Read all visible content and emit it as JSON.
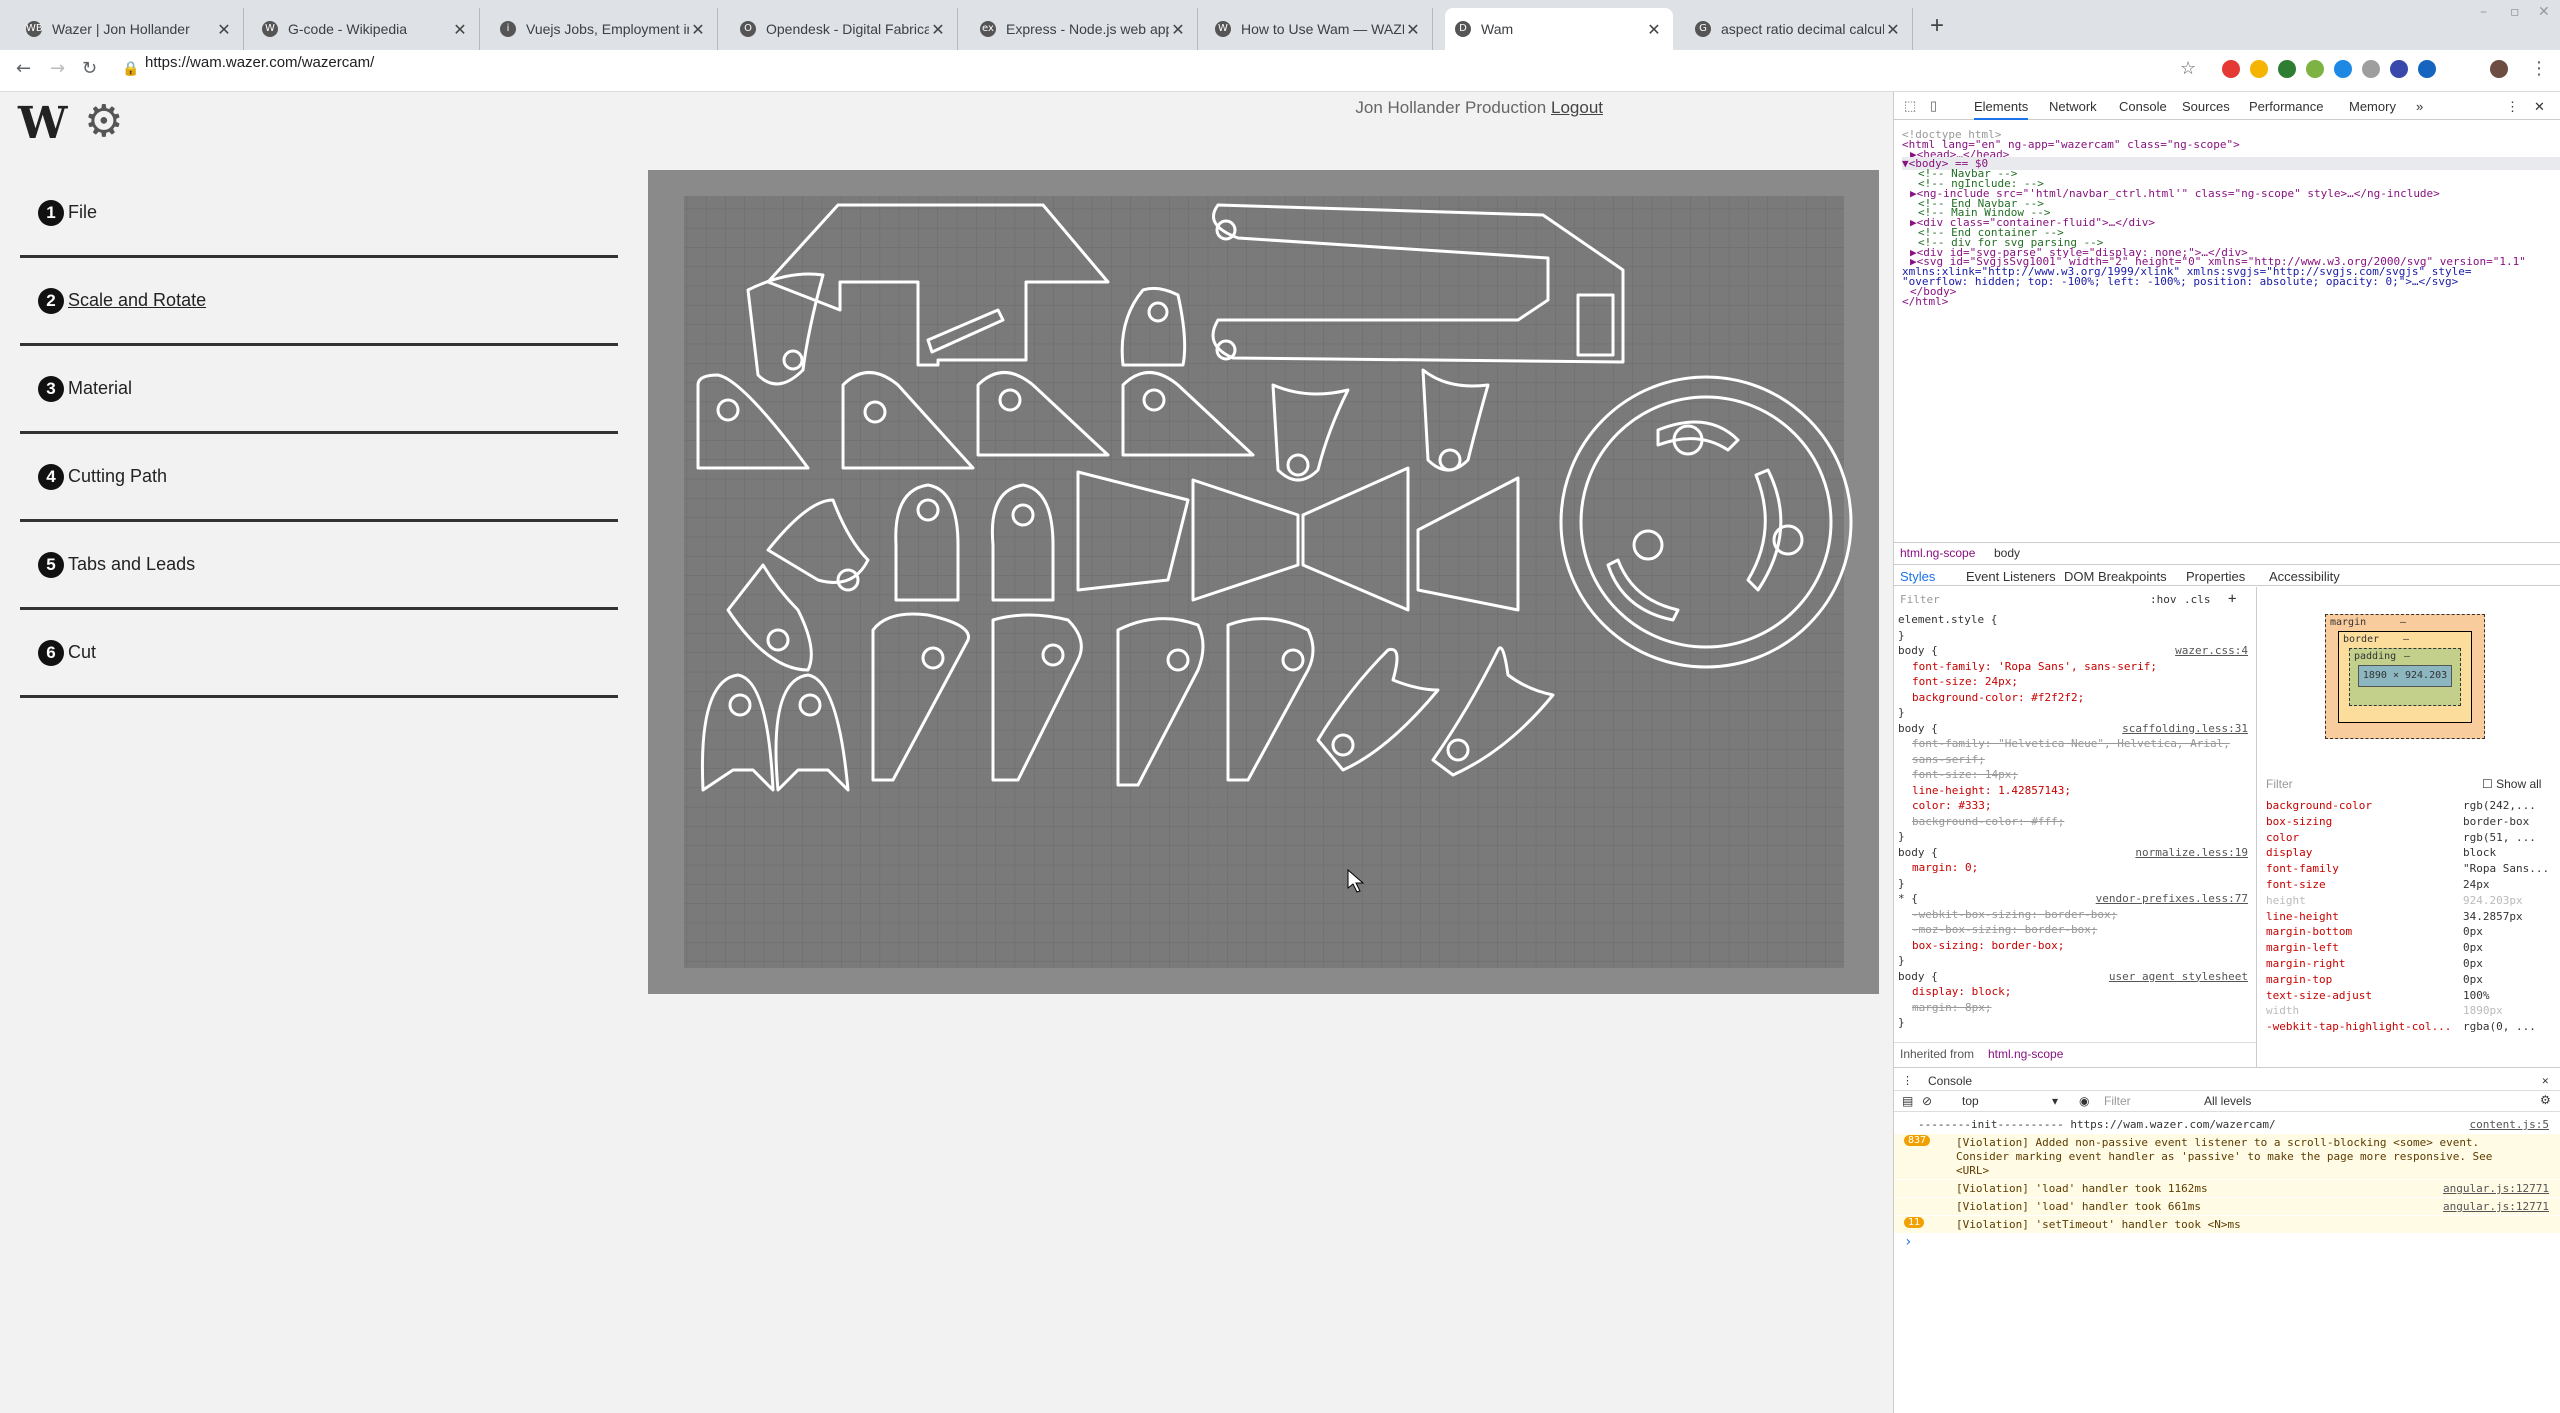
{
  "tabs": [
    {
      "label": "Wazer | Jon Hollander",
      "icon": "WB"
    },
    {
      "label": "G-code - Wikipedia",
      "icon": "W"
    },
    {
      "label": "Vuejs Jobs, Employment in San",
      "icon": "i"
    },
    {
      "label": "Opendesk - Digital Fabrication",
      "icon": "O"
    },
    {
      "label": "Express - Node.js web applicati",
      "icon": "ex"
    },
    {
      "label": "How to Use Wam — WAZER | T",
      "icon": "W"
    },
    {
      "label": "Wam",
      "icon": "D"
    },
    {
      "label": "aspect ratio decimal calculator",
      "icon": "G"
    }
  ],
  "url": "https://wam.wazer.com/wazercam/",
  "app": {
    "logo": "W",
    "user": "Jon Hollander Production",
    "logout": "Logout",
    "steps": [
      {
        "num": "1",
        "label": "File"
      },
      {
        "num": "2",
        "label": "Scale and Rotate"
      },
      {
        "num": "3",
        "label": "Material"
      },
      {
        "num": "4",
        "label": "Cutting Path"
      },
      {
        "num": "5",
        "label": "Tabs and Leads"
      },
      {
        "num": "6",
        "label": "Cut"
      }
    ]
  },
  "devtools": {
    "tabs": [
      "Elements",
      "Network",
      "Console",
      "Sources",
      "Performance",
      "Memory"
    ],
    "dom": [
      "<!doctype html>",
      "<html lang=\"en\" ng-app=\"wazercam\" class=\"ng-scope\">",
      "▶<head>…</head>",
      "▼<body> == $0",
      "<!-- Navbar -->",
      "<!-- ngInclude: -->",
      "▶<ng-include src=\"'html/navbar_ctrl.html'\" class=\"ng-scope\" style>…</ng-include>",
      "<!-- End Navbar -->",
      "<!-- Main Window -->",
      "▶<div class=\"container-fluid\">…</div>",
      "<!-- End container -->",
      "<!-- div for svg parsing -->",
      "▶<div id=\"svg-parse\" style=\"display: none;\">…</div>",
      "▶<svg id=\"SvgjsSvg1001\" width=\"2\" height=\"0\" xmlns=\"http://www.w3.org/2000/svg\" version=\"1.1\"",
      "xmlns:xlink=\"http://www.w3.org/1999/xlink\" xmlns:svgjs=\"http://svgjs.com/svgjs\" style=",
      "\"overflow: hidden; top: -100%; left: -100%; position: absolute; opacity: 0;\">…</svg>",
      "</body>",
      "</html>"
    ],
    "crumbs": [
      "html.ng-scope",
      "body"
    ],
    "subtabs": [
      "Styles",
      "Event Listeners",
      "DOM Breakpoints",
      "Properties",
      "Accessibility"
    ],
    "filter": "Filter",
    "hov": ":hov",
    "cls": ".cls",
    "styles": [
      {
        "text": "element.style {",
        "cls": "",
        "src": ""
      },
      {
        "text": "}",
        "cls": "",
        "src": ""
      },
      {
        "text": "body {",
        "cls": "",
        "src": "wazer.css:4"
      },
      {
        "text": "font-family: 'Ropa Sans', sans-serif;",
        "cls": "prop",
        "src": ""
      },
      {
        "text": "font-size: 24px;",
        "cls": "prop",
        "src": ""
      },
      {
        "text": "background-color: #f2f2f2;",
        "cls": "prop",
        "src": ""
      },
      {
        "text": "}",
        "cls": "",
        "src": ""
      },
      {
        "text": "body {",
        "cls": "",
        "src": "scaffolding.less:31"
      },
      {
        "text": "font-family: \"Helvetica Neue\", Helvetica, Arial,",
        "cls": "strike",
        "src": ""
      },
      {
        "text": "sans-serif;",
        "cls": "strike",
        "src": ""
      },
      {
        "text": "font-size: 14px;",
        "cls": "strike",
        "src": ""
      },
      {
        "text": "line-height: 1.42857143;",
        "cls": "prop",
        "src": ""
      },
      {
        "text": "color: #333;",
        "cls": "prop",
        "src": ""
      },
      {
        "text": "background-color: #fff;",
        "cls": "strike",
        "src": ""
      },
      {
        "text": "}",
        "cls": "",
        "src": ""
      },
      {
        "text": "body {",
        "cls": "",
        "src": "normalize.less:19"
      },
      {
        "text": "margin: 0;",
        "cls": "prop",
        "src": ""
      },
      {
        "text": "}",
        "cls": "",
        "src": ""
      },
      {
        "text": "* {",
        "cls": "",
        "src": "vendor-prefixes.less:77"
      },
      {
        "text": "-webkit-box-sizing: border-box;",
        "cls": "strike",
        "src": ""
      },
      {
        "text": "-moz-box-sizing: border-box;",
        "cls": "strike",
        "src": ""
      },
      {
        "text": "box-sizing: border-box;",
        "cls": "prop",
        "src": ""
      },
      {
        "text": "}",
        "cls": "",
        "src": ""
      },
      {
        "text": "body {",
        "cls": "",
        "src": "user agent stylesheet"
      },
      {
        "text": "display: block;",
        "cls": "prop",
        "src": ""
      },
      {
        "text": "margin: 8px;",
        "cls": "strike",
        "src": ""
      },
      {
        "text": "}",
        "cls": "",
        "src": ""
      }
    ],
    "inherited": "Inherited from",
    "inherited_from": "html.ng-scope",
    "boxmodel": {
      "margin": "margin",
      "border": "border",
      "padding": "padding",
      "content": "1890 × 924.203",
      "dash": "–"
    },
    "show_all": "Show all",
    "computed": [
      {
        "prop": "background-color",
        "val": "rgb(242,..."
      },
      {
        "prop": "box-sizing",
        "val": "border-box"
      },
      {
        "prop": "color",
        "val": "rgb(51, ..."
      },
      {
        "prop": "display",
        "val": "block"
      },
      {
        "prop": "font-family",
        "val": "\"Ropa Sans..."
      },
      {
        "prop": "font-size",
        "val": "24px"
      },
      {
        "prop": "height",
        "val": "924.203px"
      },
      {
        "prop": "line-height",
        "val": "34.2857px"
      },
      {
        "prop": "margin-bottom",
        "val": "0px"
      },
      {
        "prop": "margin-left",
        "val": "0px"
      },
      {
        "prop": "margin-right",
        "val": "0px"
      },
      {
        "prop": "margin-top",
        "val": "0px"
      },
      {
        "prop": "text-size-adjust",
        "val": "100%"
      },
      {
        "prop": "width",
        "val": "1890px"
      },
      {
        "prop": "-webkit-tap-highlight-col...",
        "val": "rgba(0, ..."
      }
    ],
    "console": {
      "title": "Console",
      "context": "top",
      "filter": "Filter",
      "levels": "All levels",
      "lines": [
        {
          "badge": "",
          "text": "--------init---------- https://wam.wazer.com/wazercam/",
          "src": "content.js:5",
          "warn": false
        },
        {
          "badge": "837",
          "text": "[Violation] Added non-passive event listener to a scroll-blocking <some> event.",
          "src": "",
          "warn": true
        },
        {
          "badge": "",
          "text": "Consider marking event handler as 'passive' to make the page more responsive. See",
          "src": "",
          "warn": true
        },
        {
          "badge": "",
          "text": "<URL>",
          "src": "",
          "warn": true
        },
        {
          "badge": "",
          "text": "[Violation] 'load' handler took 1162ms",
          "src": "angular.js:12771",
          "warn": true
        },
        {
          "badge": "",
          "text": "[Violation] 'load' handler took 661ms",
          "src": "angular.js:12771",
          "warn": true
        },
        {
          "badge": "11",
          "text": "[Violation] 'setTimeout' handler took <N>ms",
          "src": "",
          "warn": true
        }
      ],
      "prompt": "›"
    }
  }
}
